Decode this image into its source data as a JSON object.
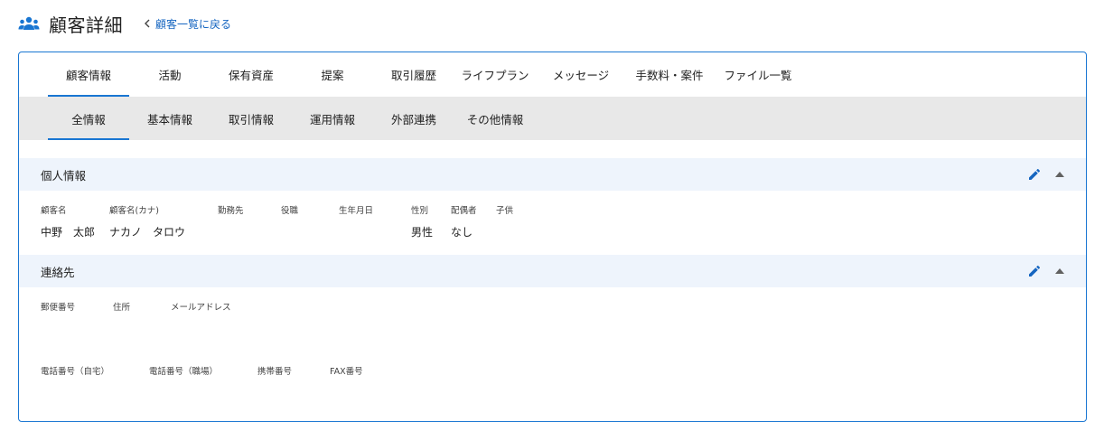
{
  "header": {
    "title": "顧客詳細",
    "back_label": "顧客一覧に戻る"
  },
  "colors": {
    "accent": "#1976d2",
    "section_bg": "#eef4fc",
    "subtab_bg": "#e8e8e8"
  },
  "icons": {
    "header": "people-icon",
    "back": "chevron-left-icon",
    "edit": "pencil-icon",
    "collapse": "caret-up-icon"
  },
  "main_tabs": [
    {
      "label": "顧客情報",
      "active": true
    },
    {
      "label": "活動"
    },
    {
      "label": "保有資産"
    },
    {
      "label": "提案"
    },
    {
      "label": "取引履歴"
    },
    {
      "label": "ライフプラン"
    },
    {
      "label": "メッセージ"
    },
    {
      "label": "手数料・案件"
    },
    {
      "label": "ファイル一覧"
    }
  ],
  "sub_tabs": [
    {
      "label": "全情報",
      "active": true
    },
    {
      "label": "基本情報"
    },
    {
      "label": "取引情報"
    },
    {
      "label": "運用情報"
    },
    {
      "label": "外部連携"
    },
    {
      "label": "その他情報"
    }
  ],
  "personal": {
    "title": "個人情報",
    "fields": [
      {
        "label": "顧客名",
        "value": "中野　太郎"
      },
      {
        "label": "顧客名(カナ)",
        "value": "ナカノ　タロウ"
      },
      {
        "label": "勤務先",
        "value": ""
      },
      {
        "label": "役職",
        "value": ""
      },
      {
        "label": "生年月日",
        "value": ""
      },
      {
        "label": "性別",
        "value": "男性"
      },
      {
        "label": "配偶者",
        "value": "なし"
      },
      {
        "label": "子供",
        "value": ""
      }
    ]
  },
  "contact": {
    "title": "連絡先",
    "fields_row1": [
      {
        "label": "郵便番号",
        "value": ""
      },
      {
        "label": "住所",
        "value": ""
      },
      {
        "label": "メールアドレス",
        "value": ""
      }
    ],
    "fields_row2": [
      {
        "label": "電話番号（自宅）",
        "value": ""
      },
      {
        "label": "電話番号（職場）",
        "value": ""
      },
      {
        "label": "携帯番号",
        "value": ""
      },
      {
        "label": "FAX番号",
        "value": ""
      }
    ]
  }
}
